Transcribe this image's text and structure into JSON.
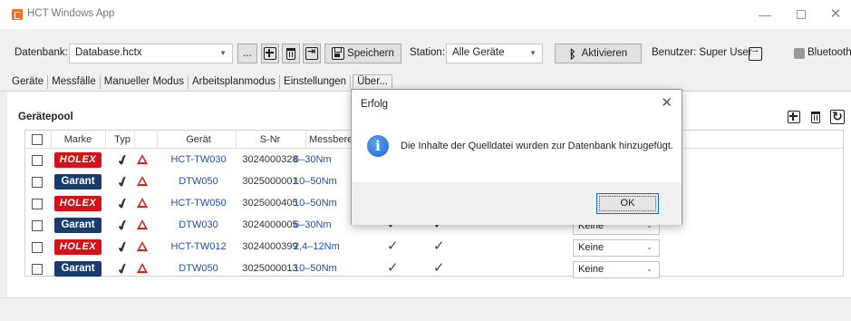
{
  "window": {
    "title": "HCT Windows App",
    "minimize_glyph": "—",
    "close_glyph": "✕"
  },
  "toolbar": {
    "database_label": "Datenbank:",
    "database_value": "Database.hctx",
    "browse_label": "...",
    "save_label": "Speichern",
    "station_label": "Station:",
    "station_value": "Alle Geräte",
    "activate_label": "Aktivieren",
    "user_label": "Benutzer: Super User",
    "bluetooth_label": "Bluetooth"
  },
  "tabs": [
    "Geräte",
    "Messfälle",
    "Manueller Modus",
    "Arbeitsplanmodus",
    "Einstellungen",
    "Über..."
  ],
  "pool": {
    "title": "Gerätepool",
    "columns": {
      "marke": "Marke",
      "typ": "Typ",
      "geraet": "Gerät",
      "snr": "S-Nr",
      "messbereich": "Messbere"
    },
    "rows": [
      {
        "brand": "HOLEX",
        "device": "HCT-TW030",
        "serial": "3024000328",
        "range": "6–30Nm",
        "select": ""
      },
      {
        "brand": "Garant",
        "device": "DTW050",
        "serial": "3025000001",
        "range": "10–50Nm",
        "select": ""
      },
      {
        "brand": "HOLEX",
        "device": "HCT-TW050",
        "serial": "3025000405",
        "range": "10–50Nm",
        "select": ""
      },
      {
        "brand": "Garant",
        "device": "DTW030",
        "serial": "3024000005",
        "range": "6–30Nm",
        "select": "Keine"
      },
      {
        "brand": "HOLEX",
        "device": "HCT-TW012",
        "serial": "3024000399",
        "range": "2,4–12Nm",
        "select": "Keine"
      },
      {
        "brand": "Garant",
        "device": "DTW050",
        "serial": "3025000013",
        "range": "10–50Nm",
        "select": "Keine"
      }
    ]
  },
  "dialog": {
    "title": "Erfolg",
    "message": "Die Inhalte der Quelldatei wurden zur Datenbank hinzugefügt.",
    "ok_label": "OK",
    "close_glyph": "✕"
  },
  "colors": {
    "holex": "#d4121a",
    "garant": "#1b3d6e",
    "link_blue": "#1f50a8",
    "warning": "#d81e1e",
    "accent": "#f36f21"
  }
}
